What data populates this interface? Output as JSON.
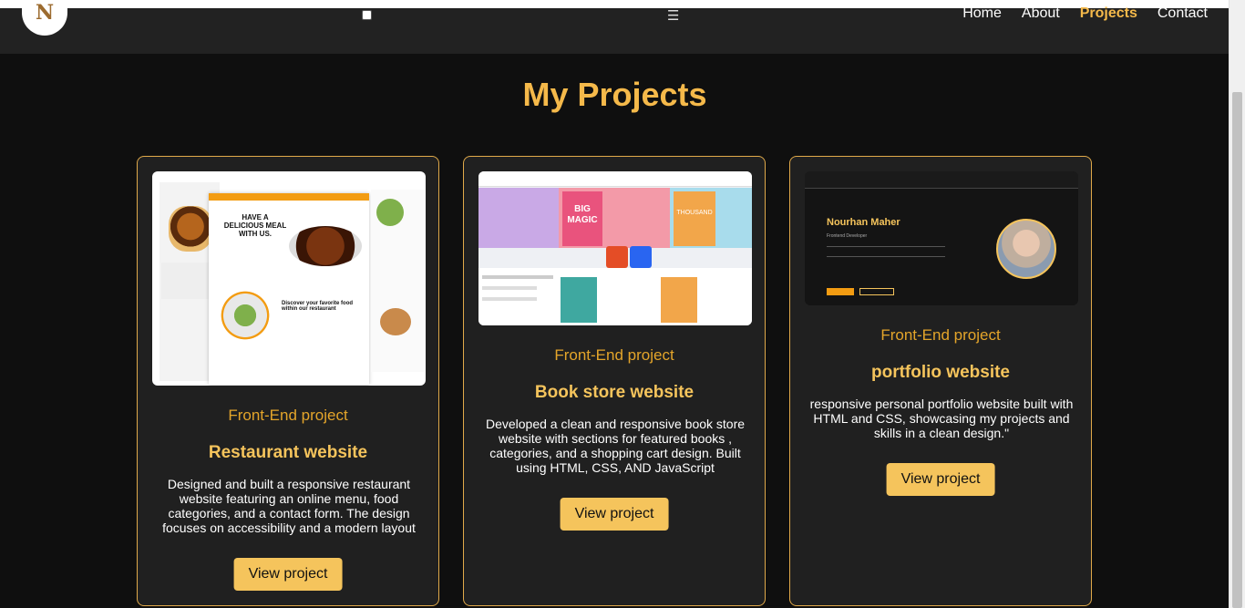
{
  "header": {
    "logo_letter": "N",
    "nav": [
      {
        "label": "Home",
        "active": false
      },
      {
        "label": "About",
        "active": false
      },
      {
        "label": "Projects",
        "active": true
      },
      {
        "label": "Contact",
        "active": false
      }
    ],
    "menu_icon": "☰"
  },
  "main": {
    "heading": "My Projects",
    "projects": [
      {
        "kind": "Front-End project",
        "title": "Restaurant website",
        "description": "Designed and built a responsive restaurant website featuring an online menu, food categories, and a contact form. The design focuses on accessibility and a modern layout",
        "button": "View project",
        "thumb_text": {
          "headline": "HAVE A DELICIOUS MEAL WITH US.",
          "section": "Discover your favorite food within our restaurant"
        }
      },
      {
        "kind": "Front-End project",
        "title": "Book store website",
        "description": "Developed a clean and responsive book store website with sections for featured books , categories, and a shopping cart design. Built using HTML, CSS, AND JavaScript",
        "button": "View project",
        "thumb_text": {
          "cover1": "BIG MAGIC",
          "cover2": "THOUSAND"
        }
      },
      {
        "kind": "Front-End project",
        "title": "portfolio website",
        "description": "responsive personal portfolio website built with HTML and CSS, showcasing my projects and skills in a clean design.\"",
        "button": "View project",
        "thumb_text": {
          "name": "Nourhan Maher",
          "role": "Frontend Developer"
        }
      }
    ]
  },
  "colors": {
    "accent": "#f5c45c",
    "accent_dark": "#e4a52a",
    "card_bg": "#202020",
    "page_bg": "#0f0f0f"
  }
}
